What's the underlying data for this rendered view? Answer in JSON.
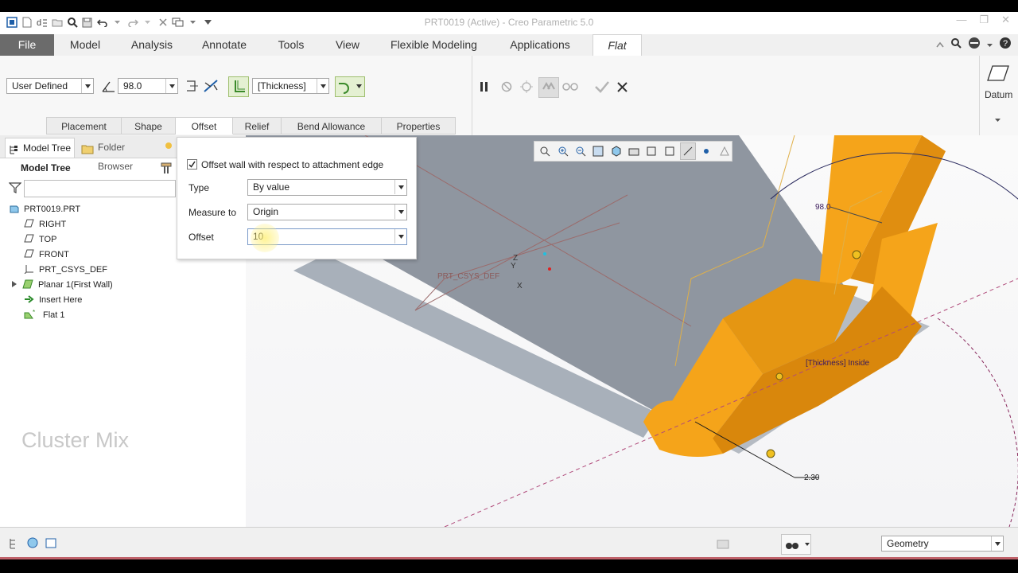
{
  "window": {
    "title": "PRT0019 (Active) - Creo Parametric 5.0"
  },
  "menu": {
    "tabs": [
      "File",
      "Model",
      "Analysis",
      "Annotate",
      "Tools",
      "View",
      "Flexible Modeling",
      "Applications",
      "Flat"
    ]
  },
  "ribbon": {
    "shape_select": "User Defined",
    "angle_value": "98.0",
    "thickness_select": "[Thickness]",
    "datum_label": "Datum",
    "subtabs": [
      "Placement",
      "Shape",
      "Offset",
      "Relief",
      "Bend Allowance",
      "Properties"
    ],
    "active_subtab": "Offset"
  },
  "left_panel": {
    "tabs": [
      "Model Tree",
      "Folder Browser"
    ],
    "title": "Model Tree",
    "filter_placeholder": "",
    "items": [
      {
        "label": "PRT0019.PRT",
        "icon": "part-icon"
      },
      {
        "label": "RIGHT",
        "icon": "datum-plane-icon"
      },
      {
        "label": "TOP",
        "icon": "datum-plane-icon"
      },
      {
        "label": "FRONT",
        "icon": "datum-plane-icon"
      },
      {
        "label": "PRT_CSYS_DEF",
        "icon": "csys-icon"
      },
      {
        "label": "Planar 1(First Wall)",
        "icon": "planar-wall-icon"
      },
      {
        "label": "Insert Here",
        "icon": "insert-arrow-icon"
      },
      {
        "label": "Flat 1",
        "icon": "flat-wall-icon"
      }
    ]
  },
  "offset_panel": {
    "checkbox_label": "Offset wall with respect to attachment edge",
    "checkbox_checked": true,
    "type_label": "Type",
    "type_value": "By value",
    "measure_label": "Measure to",
    "measure_value": "Origin",
    "offset_label": "Offset",
    "offset_value": "10"
  },
  "viewport": {
    "angle_dim": "98.0",
    "thickness_label": "[Thickness] Inside",
    "dim_value": "2.30",
    "csys_label": "PRT_CSYS_DEF"
  },
  "watermark": "Cluster Mix",
  "statusbar": {
    "filter_value": "Geometry"
  },
  "colors": {
    "accent": "#f5a41a",
    "file_tab": "#6b6b6b",
    "part_grey": "#8f96a0"
  }
}
